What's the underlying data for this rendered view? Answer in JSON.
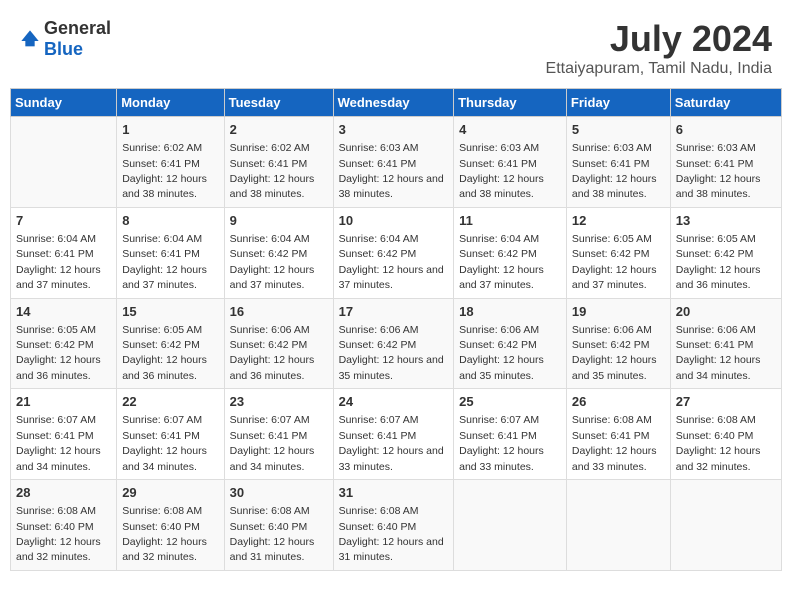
{
  "header": {
    "logo_general": "General",
    "logo_blue": "Blue",
    "title": "July 2024",
    "subtitle": "Ettaiyapuram, Tamil Nadu, India"
  },
  "columns": [
    "Sunday",
    "Monday",
    "Tuesday",
    "Wednesday",
    "Thursday",
    "Friday",
    "Saturday"
  ],
  "weeks": [
    [
      {
        "day": "",
        "empty": true
      },
      {
        "day": "1",
        "sunrise": "6:02 AM",
        "sunset": "6:41 PM",
        "daylight": "12 hours and 38 minutes."
      },
      {
        "day": "2",
        "sunrise": "6:02 AM",
        "sunset": "6:41 PM",
        "daylight": "12 hours and 38 minutes."
      },
      {
        "day": "3",
        "sunrise": "6:03 AM",
        "sunset": "6:41 PM",
        "daylight": "12 hours and 38 minutes."
      },
      {
        "day": "4",
        "sunrise": "6:03 AM",
        "sunset": "6:41 PM",
        "daylight": "12 hours and 38 minutes."
      },
      {
        "day": "5",
        "sunrise": "6:03 AM",
        "sunset": "6:41 PM",
        "daylight": "12 hours and 38 minutes."
      },
      {
        "day": "6",
        "sunrise": "6:03 AM",
        "sunset": "6:41 PM",
        "daylight": "12 hours and 38 minutes."
      }
    ],
    [
      {
        "day": "7",
        "sunrise": "6:04 AM",
        "sunset": "6:41 PM",
        "daylight": "12 hours and 37 minutes."
      },
      {
        "day": "8",
        "sunrise": "6:04 AM",
        "sunset": "6:41 PM",
        "daylight": "12 hours and 37 minutes."
      },
      {
        "day": "9",
        "sunrise": "6:04 AM",
        "sunset": "6:42 PM",
        "daylight": "12 hours and 37 minutes."
      },
      {
        "day": "10",
        "sunrise": "6:04 AM",
        "sunset": "6:42 PM",
        "daylight": "12 hours and 37 minutes."
      },
      {
        "day": "11",
        "sunrise": "6:04 AM",
        "sunset": "6:42 PM",
        "daylight": "12 hours and 37 minutes."
      },
      {
        "day": "12",
        "sunrise": "6:05 AM",
        "sunset": "6:42 PM",
        "daylight": "12 hours and 37 minutes."
      },
      {
        "day": "13",
        "sunrise": "6:05 AM",
        "sunset": "6:42 PM",
        "daylight": "12 hours and 36 minutes."
      }
    ],
    [
      {
        "day": "14",
        "sunrise": "6:05 AM",
        "sunset": "6:42 PM",
        "daylight": "12 hours and 36 minutes."
      },
      {
        "day": "15",
        "sunrise": "6:05 AM",
        "sunset": "6:42 PM",
        "daylight": "12 hours and 36 minutes."
      },
      {
        "day": "16",
        "sunrise": "6:06 AM",
        "sunset": "6:42 PM",
        "daylight": "12 hours and 36 minutes."
      },
      {
        "day": "17",
        "sunrise": "6:06 AM",
        "sunset": "6:42 PM",
        "daylight": "12 hours and 35 minutes."
      },
      {
        "day": "18",
        "sunrise": "6:06 AM",
        "sunset": "6:42 PM",
        "daylight": "12 hours and 35 minutes."
      },
      {
        "day": "19",
        "sunrise": "6:06 AM",
        "sunset": "6:42 PM",
        "daylight": "12 hours and 35 minutes."
      },
      {
        "day": "20",
        "sunrise": "6:06 AM",
        "sunset": "6:41 PM",
        "daylight": "12 hours and 34 minutes."
      }
    ],
    [
      {
        "day": "21",
        "sunrise": "6:07 AM",
        "sunset": "6:41 PM",
        "daylight": "12 hours and 34 minutes."
      },
      {
        "day": "22",
        "sunrise": "6:07 AM",
        "sunset": "6:41 PM",
        "daylight": "12 hours and 34 minutes."
      },
      {
        "day": "23",
        "sunrise": "6:07 AM",
        "sunset": "6:41 PM",
        "daylight": "12 hours and 34 minutes."
      },
      {
        "day": "24",
        "sunrise": "6:07 AM",
        "sunset": "6:41 PM",
        "daylight": "12 hours and 33 minutes."
      },
      {
        "day": "25",
        "sunrise": "6:07 AM",
        "sunset": "6:41 PM",
        "daylight": "12 hours and 33 minutes."
      },
      {
        "day": "26",
        "sunrise": "6:08 AM",
        "sunset": "6:41 PM",
        "daylight": "12 hours and 33 minutes."
      },
      {
        "day": "27",
        "sunrise": "6:08 AM",
        "sunset": "6:40 PM",
        "daylight": "12 hours and 32 minutes."
      }
    ],
    [
      {
        "day": "28",
        "sunrise": "6:08 AM",
        "sunset": "6:40 PM",
        "daylight": "12 hours and 32 minutes."
      },
      {
        "day": "29",
        "sunrise": "6:08 AM",
        "sunset": "6:40 PM",
        "daylight": "12 hours and 32 minutes."
      },
      {
        "day": "30",
        "sunrise": "6:08 AM",
        "sunset": "6:40 PM",
        "daylight": "12 hours and 31 minutes."
      },
      {
        "day": "31",
        "sunrise": "6:08 AM",
        "sunset": "6:40 PM",
        "daylight": "12 hours and 31 minutes."
      },
      {
        "day": "",
        "empty": true
      },
      {
        "day": "",
        "empty": true
      },
      {
        "day": "",
        "empty": true
      }
    ]
  ]
}
